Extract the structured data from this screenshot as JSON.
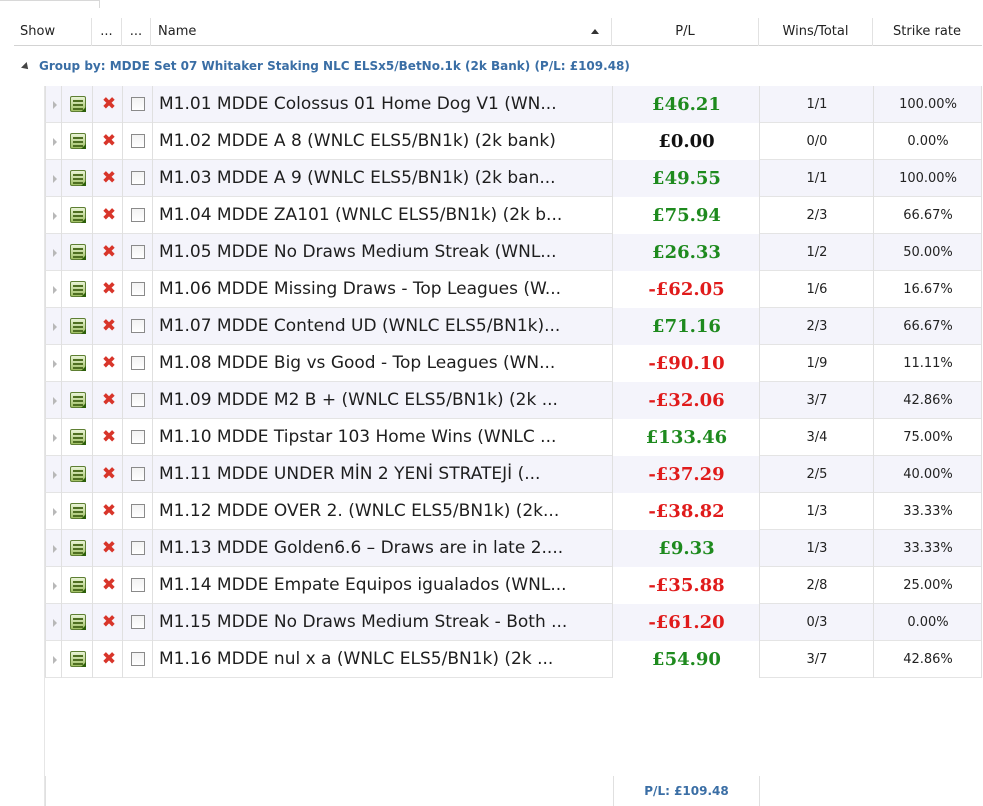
{
  "header": {
    "show": "Show",
    "col2": "...",
    "col3": "...",
    "name": "Name",
    "pl": "P/L",
    "wins_total": "Wins/Total",
    "strike_rate": "Strike rate"
  },
  "group": {
    "label": "Group by: MDDE Set 07 Whitaker Staking NLC ELSx5/BetNo.1k  (2k Bank) (P/L: £109.48)"
  },
  "rows": [
    {
      "name": "M1.01 MDDE Colossus 01 Home Dog V1 (WN...",
      "pl": "£46.21",
      "sign": "pos",
      "wins": "1/1",
      "sr": "100.00%"
    },
    {
      "name": "M1.02 MDDE A 8 (WNLC ELS5/BN1k) (2k bank)",
      "pl": "£0.00",
      "sign": "zero",
      "wins": "0/0",
      "sr": "0.00%"
    },
    {
      "name": "M1.03 MDDE A 9  (WNLC ELS5/BN1k) (2k ban...",
      "pl": "£49.55",
      "sign": "pos",
      "wins": "1/1",
      "sr": "100.00%"
    },
    {
      "name": "M1.04 MDDE ZA101 (WNLC ELS5/BN1k) (2k b...",
      "pl": "£75.94",
      "sign": "pos",
      "wins": "2/3",
      "sr": "66.67%"
    },
    {
      "name": "M1.05 MDDE No Draws Medium Streak (WNL...",
      "pl": "£26.33",
      "sign": "pos",
      "wins": "1/2",
      "sr": "50.00%"
    },
    {
      "name": "M1.06 MDDE Missing Draws - Top Leagues (W...",
      "pl": "-£62.05",
      "sign": "neg",
      "wins": "1/6",
      "sr": "16.67%"
    },
    {
      "name": "M1.07 MDDE Contend UD (WNLC ELS5/BN1k)...",
      "pl": "£71.16",
      "sign": "pos",
      "wins": "2/3",
      "sr": "66.67%"
    },
    {
      "name": "M1.08 MDDE Big vs Good - Top Leagues (WN...",
      "pl": "-£90.10",
      "sign": "neg",
      "wins": "1/9",
      "sr": "11.11%"
    },
    {
      "name": "M1.09 MDDE M2 B + (WNLC ELS5/BN1k) (2k ...",
      "pl": "-£32.06",
      "sign": "neg",
      "wins": "3/7",
      "sr": "42.86%"
    },
    {
      "name": "M1.10 MDDE Tipstar 103 Home Wins (WNLC ...",
      "pl": "£133.46",
      "sign": "pos",
      "wins": "3/4",
      "sr": "75.00%"
    },
    {
      "name": "M1.11 MDDE UNDER MİN 2 YENİ STRATEJİ (...",
      "pl": "-£37.29",
      "sign": "neg",
      "wins": "2/5",
      "sr": "40.00%"
    },
    {
      "name": "M1.12 MDDE OVER 2. (WNLC ELS5/BN1k) (2k...",
      "pl": "-£38.82",
      "sign": "neg",
      "wins": "1/3",
      "sr": "33.33%"
    },
    {
      "name": "M1.13 MDDE Golden6.6 – Draws are in late 2....",
      "pl": "£9.33",
      "sign": "pos",
      "wins": "1/3",
      "sr": "33.33%"
    },
    {
      "name": "M1.14 MDDE Empate Equipos igualados (WNL...",
      "pl": "-£35.88",
      "sign": "neg",
      "wins": "2/8",
      "sr": "25.00%"
    },
    {
      "name": "M1.15 MDDE No Draws Medium Streak - Both ...",
      "pl": "-£61.20",
      "sign": "neg",
      "wins": "0/3",
      "sr": "0.00%"
    },
    {
      "name": "M1.16 MDDE nul x a (WNLC ELS5/BN1k) (2k ...",
      "pl": "£54.90",
      "sign": "pos",
      "wins": "3/7",
      "sr": "42.86%"
    }
  ],
  "footer": {
    "pl_total": "P/L: £109.48"
  },
  "colors": {
    "positive": "#1e8a1e",
    "negative": "#e01b1b",
    "group_text": "#3a6ea5"
  }
}
